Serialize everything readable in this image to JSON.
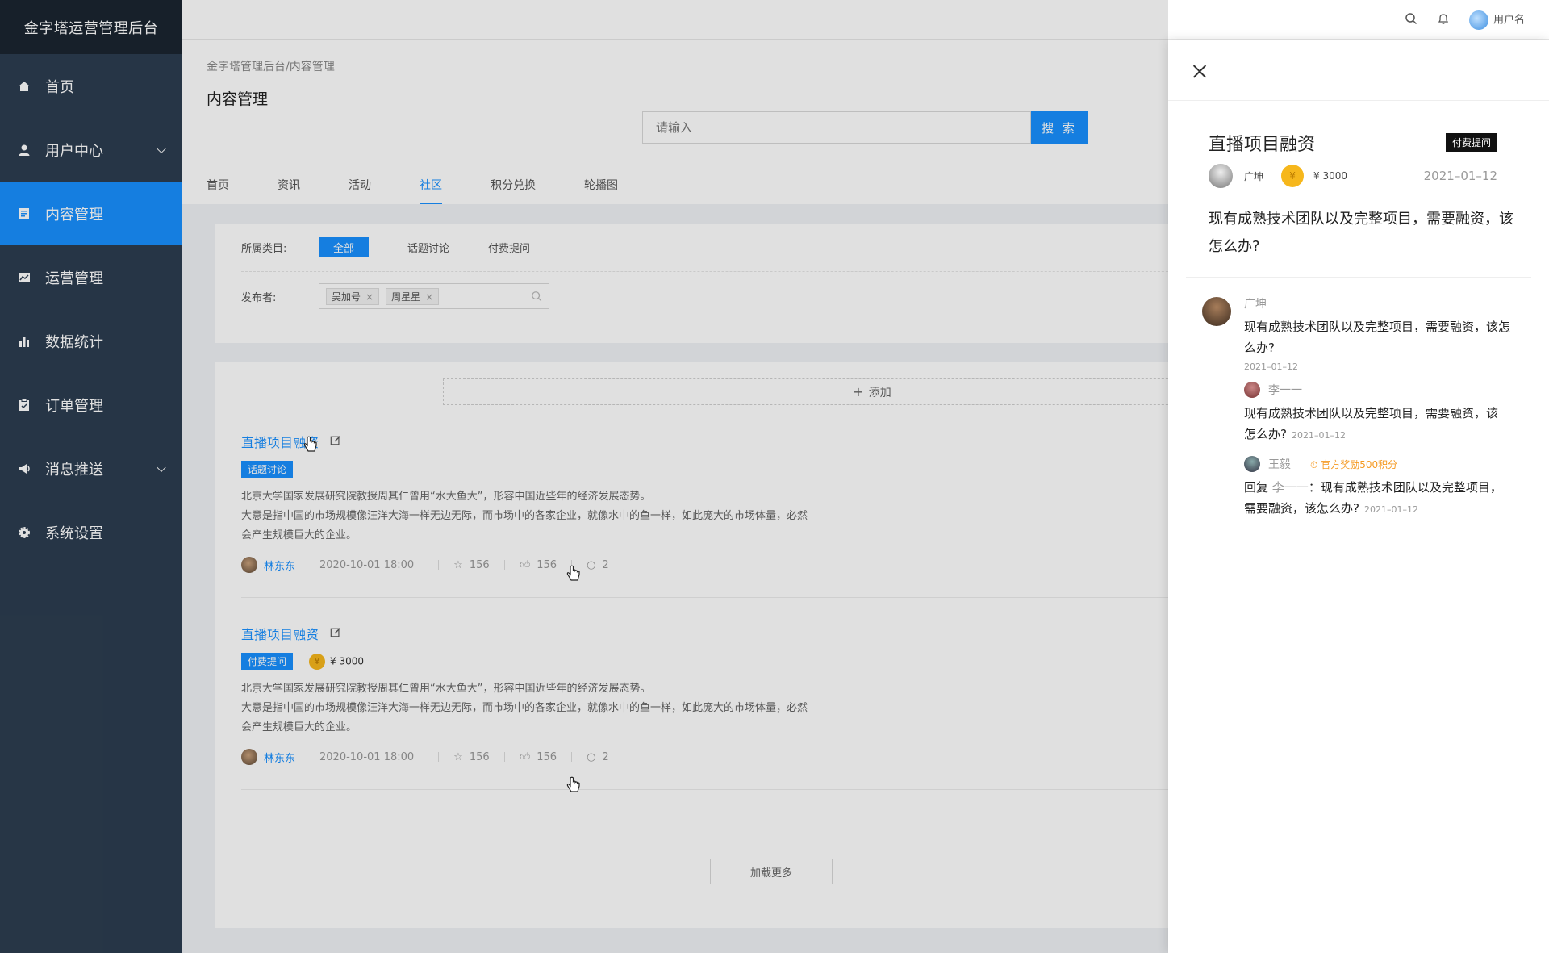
{
  "app": {
    "title": "金字塔运营管理后台"
  },
  "sidebar": {
    "items": [
      {
        "label": "首页",
        "icon": "home-icon"
      },
      {
        "label": "用户中心",
        "icon": "user-icon"
      },
      {
        "label": "内容管理",
        "icon": "document-icon"
      },
      {
        "label": "运营管理",
        "icon": "chart-board-icon"
      },
      {
        "label": "数据统计",
        "icon": "bar-chart-icon"
      },
      {
        "label": "订单管理",
        "icon": "clipboard-icon"
      },
      {
        "label": "消息推送",
        "icon": "megaphone-icon"
      },
      {
        "label": "系统设置",
        "icon": "gear-icon"
      }
    ]
  },
  "topbar": {
    "username": "用户名"
  },
  "header": {
    "breadcrumb": "金字塔管理后台/内容管理",
    "title": "内容管理",
    "search_placeholder": "请输入",
    "search_button": "搜 索",
    "tabs": [
      "首页",
      "资讯",
      "活动",
      "社区",
      "积分兑换",
      "轮播图"
    ]
  },
  "filter": {
    "category_label": "所属类目:",
    "categories": [
      "全部",
      "话题讨论",
      "付费提问"
    ],
    "publisher_label": "发布者:",
    "publishers": [
      "吴加号",
      "周星星"
    ]
  },
  "list": {
    "add_label": "添加",
    "load_more": "加载更多",
    "posts": [
      {
        "title": "直播项目融资",
        "tag": "话题讨论",
        "body_line1": "北京大学国家发展研究院教授周其仁曾用“水大鱼大”，形容中国近些年的经济发展态势。",
        "body_line2": "大意是指中国的市场规模像汪洋大海一样无边无际，而市场中的各家企业，就像水中的鱼一样，如此庞大的市场体量，必然会产生规模巨大的企业。",
        "author": "林东东",
        "time": "2020-10-01 18:00",
        "stars": "156",
        "likes": "156",
        "comments": "2"
      },
      {
        "title": "直播项目融资",
        "tag": "付费提问",
        "reward": "¥ 3000",
        "body_line1": "北京大学国家发展研究院教授周其仁曾用“水大鱼大”，形容中国近些年的经济发展态势。",
        "body_line2": "大意是指中国的市场规模像汪洋大海一样无边无际，而市场中的各家企业，就像水中的鱼一样，如此庞大的市场体量，必然会产生规模巨大的企业。",
        "author": "林东东",
        "time": "2020-10-01 18:00",
        "stars": "156",
        "likes": "156",
        "comments": "2"
      }
    ]
  },
  "drawer": {
    "title": "直播项目融资",
    "badge": "付费提问",
    "author": "广坤",
    "reward": "¥ 3000",
    "date": "2021–01–12",
    "question": "现有成熟技术团队以及完整项目，需要融资，该怎么办?",
    "comment": {
      "name": "广坤",
      "text": "现有成熟技术团队以及完整项目，需要融资，该怎么办?",
      "date": "2021–01–12"
    },
    "reply1": {
      "name": "李一一",
      "text": "现有成熟技术团队以及完整项目，需要融资，该怎么办?",
      "date": "2021–01–12"
    },
    "reply2": {
      "name": "王毅",
      "reward": "官方奖励500积分",
      "prefix": "回复",
      "target": "李一一",
      "text": "：现有成熟技术团队以及完整项目，需要融资，该怎么办?",
      "date": "2021–01–12"
    }
  },
  "colors": {
    "primary": "#1890ff",
    "sidebar": "#2c3d50",
    "brand_bar": "#1b2530",
    "gold": "#f6b71c",
    "reward": "#f59a23"
  }
}
